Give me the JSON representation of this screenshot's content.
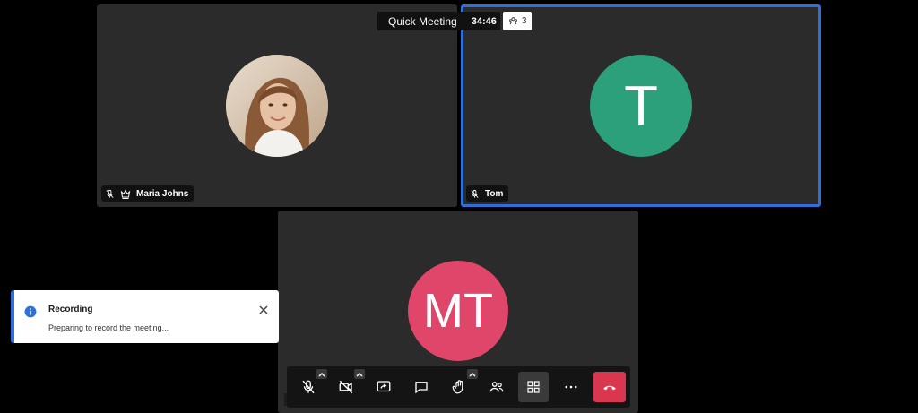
{
  "meeting": {
    "title": "Quick Meeting",
    "elapsed": "34:46",
    "participant_count": "3"
  },
  "tiles": [
    {
      "name": "Maria Johns",
      "muted": true,
      "moderator": true,
      "avatar_type": "photo",
      "active": false
    },
    {
      "name": "Tom",
      "muted": true,
      "moderator": false,
      "avatar_initials": "T",
      "avatar_color": "#2ba07a",
      "active": true
    },
    {
      "name": "",
      "avatar_initials": "MT",
      "avatar_color": "#e0466a",
      "active": false
    }
  ],
  "notification": {
    "title": "Recording",
    "message": "Preparing to record the meeting..."
  },
  "toolbar": {
    "buttons": [
      "microphone",
      "camera",
      "screen-share",
      "chat",
      "raise-hand",
      "participants",
      "tile-view",
      "more",
      "hang-up"
    ]
  },
  "colors": {
    "active_border": "#2e6fd8",
    "hangup": "#d9364f",
    "tile_bg": "#2b2b2b"
  }
}
